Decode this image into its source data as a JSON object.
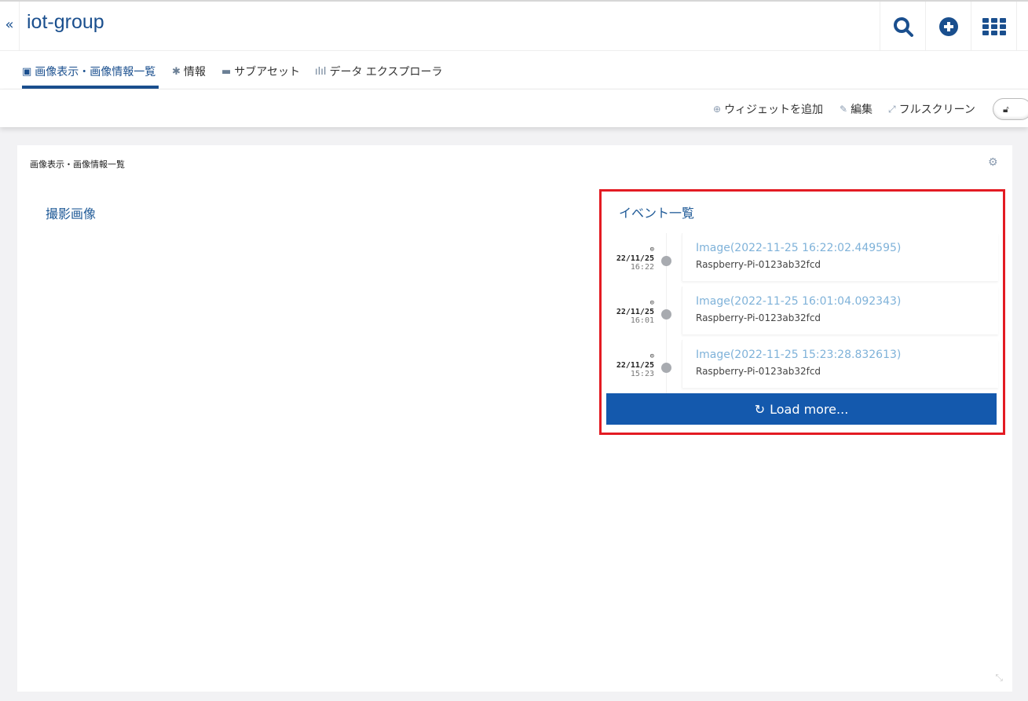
{
  "header": {
    "back_icon": "«",
    "title": "iot-group"
  },
  "tabs": [
    {
      "icon": "image-icon",
      "label": "画像表示・画像情報一覧",
      "active": true
    },
    {
      "icon": "asterisk-icon",
      "label": "情報"
    },
    {
      "icon": "folder-icon",
      "label": "サブアセット"
    },
    {
      "icon": "bar-chart-icon",
      "label": "データ エクスプローラ"
    }
  ],
  "toolbar": {
    "add_widget": "ウィジェットを追加",
    "edit": "編集",
    "fullscreen": "フルスクリーン"
  },
  "panel": {
    "title": "画像表示・画像情報一覧",
    "captured_images_title": "撮影画像",
    "events_title": "イベント一覧",
    "events": [
      {
        "date": "22/11/25",
        "time": "16:22",
        "title": "Image(2022-11-25 16:22:02.449595)",
        "device": "Raspberry-Pi-0123ab32fcd"
      },
      {
        "date": "22/11/25",
        "time": "16:01",
        "title": "Image(2022-11-25 16:01:04.092343)",
        "device": "Raspberry-Pi-0123ab32fcd"
      },
      {
        "date": "22/11/25",
        "time": "15:23",
        "title": "Image(2022-11-25 15:23:28.832613)",
        "device": "Raspberry-Pi-0123ab32fcd"
      }
    ],
    "load_more": "Load more..."
  },
  "colors": {
    "brand": "#1a4f8e",
    "button": "#1459ad",
    "highlight": "#e31b23",
    "link": "#7fb2d9"
  }
}
